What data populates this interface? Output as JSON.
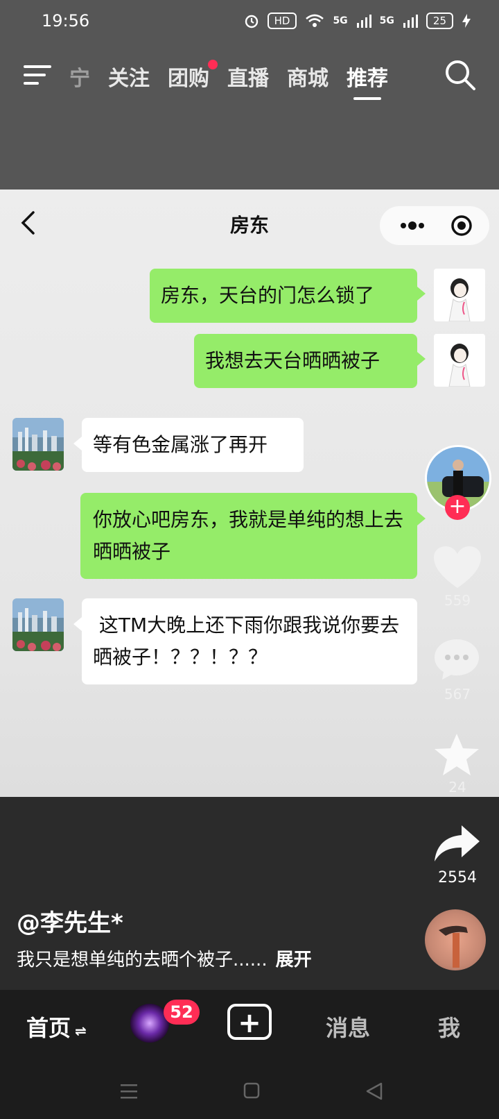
{
  "status_bar": {
    "time": "19:56",
    "hd": "HD",
    "network_1": "5G",
    "network_2": "5G",
    "battery": "25"
  },
  "top_nav": {
    "tabs": [
      {
        "label": "宁",
        "state": "faded"
      },
      {
        "label": "关注",
        "state": "normal"
      },
      {
        "label": "团购",
        "state": "dot"
      },
      {
        "label": "直播",
        "state": "normal"
      },
      {
        "label": "商城",
        "state": "normal"
      },
      {
        "label": "推荐",
        "state": "active"
      }
    ],
    "icons": [
      "menu-icon",
      "search-icon"
    ]
  },
  "chat": {
    "title": "房东",
    "messages": [
      {
        "side": "me",
        "text": "房东，天台的门怎么锁了"
      },
      {
        "side": "me",
        "text": "我想去天台晒晒被子"
      },
      {
        "side": "other",
        "text": "等有色金属涨了再开"
      },
      {
        "side": "me",
        "text": "你放心吧房东，我就是单纯的想上去晒晒被子"
      },
      {
        "side": "other",
        "text": " 这TM大晚上还下雨你跟我说你要去晒被子！？？！？？"
      }
    ]
  },
  "actions": {
    "likes": "559",
    "comments": "567",
    "favorites": "24",
    "shares": "2554",
    "follow_label": "+"
  },
  "caption": {
    "user": "@李先生*",
    "text": "我只是想单纯的去晒个被子......",
    "expand": "展开"
  },
  "bottom_nav": {
    "home": "首页",
    "home_swap": "⇌",
    "badge": "52",
    "add": "+",
    "messages": "消息",
    "me": "我"
  },
  "colors": {
    "my_bubble": "#95ec69",
    "other_bubble": "#ffffff",
    "accent_red": "#ff2d55"
  }
}
